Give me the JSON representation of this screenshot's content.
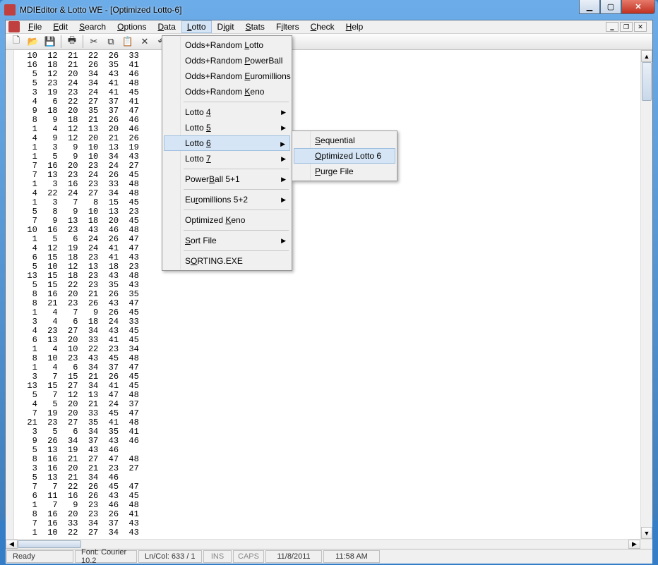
{
  "window": {
    "title": "MDIEditor & Lotto WE - [Optimized Lotto-6]"
  },
  "menubar": {
    "items": [
      "File",
      "Edit",
      "Search",
      "Options",
      "Data",
      "Lotto",
      "Digit",
      "Stats",
      "Filters",
      "Check",
      "Help"
    ],
    "underlines": [
      0,
      0,
      0,
      0,
      0,
      0,
      1,
      0,
      1,
      0,
      0
    ],
    "active": "Lotto"
  },
  "dropdown": {
    "groups": [
      {
        "items": [
          {
            "label": "Odds+Random Lotto",
            "u": [
              12
            ]
          },
          {
            "label": "Odds+Random PowerBall",
            "u": [
              12
            ]
          },
          {
            "label": "Odds+Random Euromillions",
            "u": [
              12
            ]
          },
          {
            "label": "Odds+Random Keno",
            "u": [
              12
            ]
          }
        ]
      },
      {
        "items": [
          {
            "label": "Lotto 4",
            "u": [
              6
            ],
            "sub": true
          },
          {
            "label": "Lotto 5",
            "u": [
              6
            ],
            "sub": true
          },
          {
            "label": "Lotto 6",
            "u": [
              6
            ],
            "sub": true,
            "hover": true
          },
          {
            "label": "Lotto 7",
            "u": [
              6
            ],
            "sub": true
          }
        ]
      },
      {
        "items": [
          {
            "label": "PowerBall 5+1",
            "u": [
              5
            ],
            "sub": true
          }
        ]
      },
      {
        "items": [
          {
            "label": "Euromillions 5+2",
            "u": [
              2
            ],
            "sub": true
          }
        ]
      },
      {
        "items": [
          {
            "label": "Optimized Keno",
            "u": [
              10
            ]
          }
        ]
      },
      {
        "items": [
          {
            "label": "Sort File",
            "u": [
              0
            ],
            "sub": true
          }
        ]
      },
      {
        "items": [
          {
            "label": "SORTING.EXE",
            "u": [
              1
            ]
          }
        ]
      }
    ]
  },
  "submenu": {
    "items": [
      {
        "label": "Sequential",
        "u": [
          0
        ]
      },
      {
        "label": "Optimized Lotto 6",
        "u": [
          0
        ],
        "hover": true
      },
      {
        "label": "Purge File",
        "u": [
          0
        ]
      }
    ]
  },
  "lotto_rows": [
    [
      10,
      12,
      21,
      22,
      26,
      33
    ],
    [
      16,
      18,
      21,
      26,
      35,
      41
    ],
    [
      5,
      12,
      20,
      34,
      43,
      46
    ],
    [
      5,
      23,
      24,
      34,
      41,
      48
    ],
    [
      3,
      19,
      23,
      24,
      41,
      45
    ],
    [
      4,
      6,
      22,
      27,
      37,
      41
    ],
    [
      9,
      18,
      20,
      35,
      37,
      47
    ],
    [
      8,
      9,
      18,
      21,
      26,
      46
    ],
    [
      1,
      4,
      12,
      13,
      20,
      46
    ],
    [
      4,
      9,
      12,
      20,
      21,
      26
    ],
    [
      1,
      3,
      9,
      10,
      13,
      19
    ],
    [
      1,
      5,
      9,
      10,
      34,
      43
    ],
    [
      7,
      16,
      20,
      23,
      24,
      27
    ],
    [
      7,
      13,
      23,
      24,
      26,
      45
    ],
    [
      1,
      3,
      16,
      23,
      33,
      48
    ],
    [
      4,
      22,
      24,
      27,
      34,
      48
    ],
    [
      1,
      3,
      7,
      8,
      15,
      45
    ],
    [
      5,
      8,
      9,
      10,
      13,
      23
    ],
    [
      7,
      9,
      13,
      18,
      20,
      45
    ],
    [
      10,
      16,
      23,
      43,
      46,
      48
    ],
    [
      1,
      5,
      6,
      24,
      26,
      47
    ],
    [
      4,
      12,
      19,
      24,
      41,
      47
    ],
    [
      6,
      15,
      18,
      23,
      41,
      43
    ],
    [
      5,
      10,
      12,
      13,
      18,
      23
    ],
    [
      13,
      15,
      18,
      23,
      43,
      48
    ],
    [
      5,
      15,
      22,
      23,
      35,
      43
    ],
    [
      8,
      16,
      20,
      21,
      26,
      35
    ],
    [
      8,
      21,
      23,
      26,
      43,
      47
    ],
    [
      1,
      4,
      7,
      9,
      26,
      45
    ],
    [
      3,
      4,
      6,
      18,
      24,
      33
    ],
    [
      4,
      23,
      27,
      34,
      43,
      45
    ],
    [
      6,
      13,
      20,
      33,
      41,
      45
    ],
    [
      1,
      4,
      10,
      22,
      23,
      34
    ],
    [
      8,
      10,
      23,
      43,
      45,
      48
    ],
    [
      1,
      4,
      6,
      34,
      37,
      47
    ],
    [
      3,
      7,
      15,
      21,
      26,
      45
    ],
    [
      13,
      15,
      27,
      34,
      41,
      45
    ],
    [
      5,
      7,
      12,
      13,
      47,
      48
    ],
    [
      4,
      5,
      20,
      21,
      24,
      37
    ],
    [
      7,
      19,
      20,
      33,
      45,
      47
    ],
    [
      21,
      23,
      27,
      35,
      41,
      48
    ],
    [
      3,
      5,
      6,
      34,
      35,
      41
    ],
    [
      9,
      26,
      34,
      37,
      43,
      46
    ],
    [
      5,
      13,
      19,
      43,
      46
    ],
    [
      8,
      16,
      21,
      27,
      47,
      48
    ],
    [
      3,
      16,
      20,
      21,
      23,
      27
    ],
    [
      5,
      13,
      21,
      34,
      46
    ],
    [
      7,
      7,
      22,
      26,
      45,
      47
    ],
    [
      6,
      11,
      16,
      26,
      43,
      45
    ],
    [
      1,
      7,
      9,
      23,
      46,
      48
    ],
    [
      8,
      16,
      20,
      23,
      26,
      41
    ],
    [
      7,
      16,
      33,
      34,
      37,
      43
    ],
    [
      1,
      10,
      22,
      27,
      34,
      43
    ]
  ],
  "toolbar": {
    "buttons": [
      "new",
      "open",
      "save",
      "print",
      "cut",
      "copy",
      "paste",
      "delete",
      "undo",
      "find",
      "run1",
      "run2"
    ]
  },
  "status": {
    "ready": "Ready",
    "font": "Font: Courier 10.2",
    "lncol": "Ln/Col: 633 / 1",
    "ins": "INS",
    "caps": "CAPS",
    "date": "11/8/2011",
    "time": "11:58 AM"
  }
}
